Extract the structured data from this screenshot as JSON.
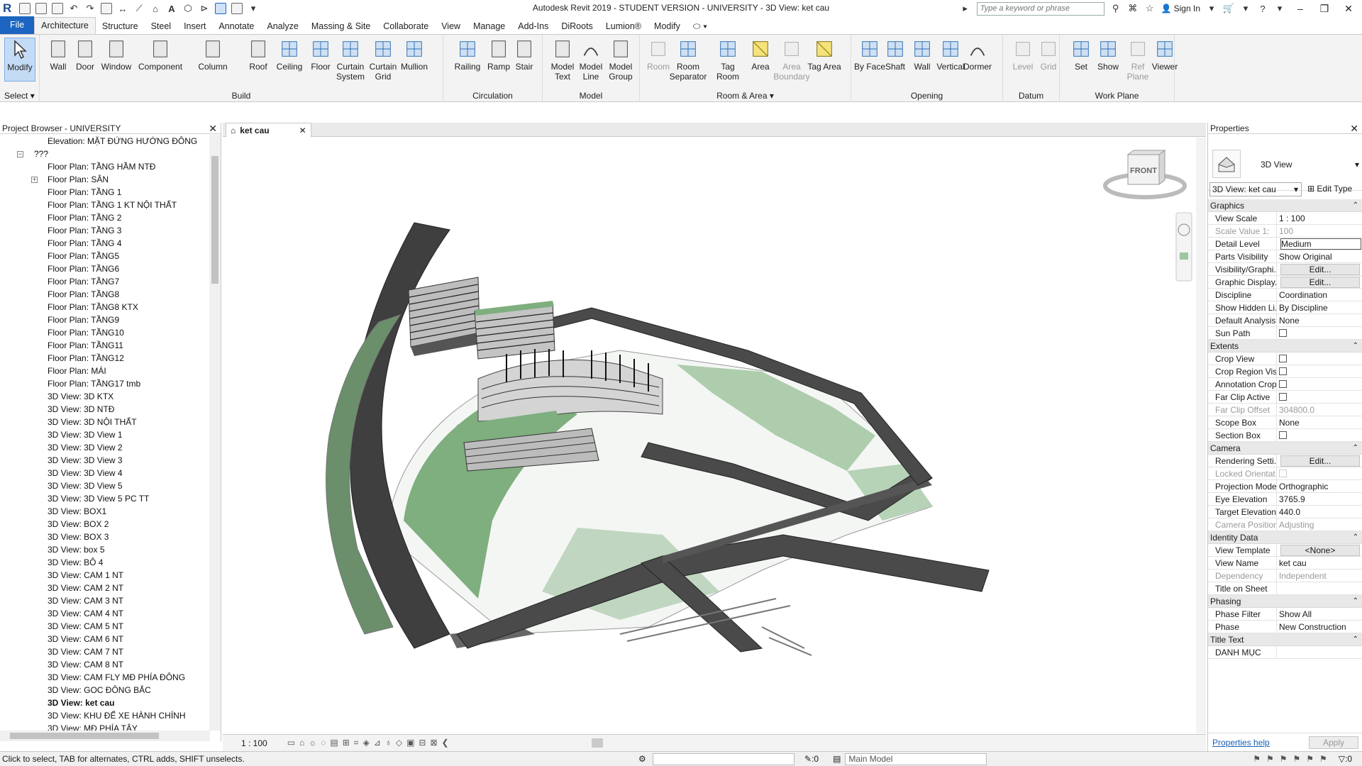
{
  "app": {
    "title": "Autodesk Revit 2019 - STUDENT VERSION - UNIVERSITY - 3D View: ket cau",
    "search_placeholder": "Type a keyword or phrase",
    "sign_in": "Sign In"
  },
  "tabs": [
    "File",
    "Architecture",
    "Structure",
    "Steel",
    "Insert",
    "Annotate",
    "Analyze",
    "Massing & Site",
    "Collaborate",
    "View",
    "Manage",
    "Add-Ins",
    "DiRoots",
    "Lumion®",
    "Modify"
  ],
  "ribbon": {
    "select_label": "Select",
    "modify": "Modify",
    "build": {
      "title": "Build",
      "items": [
        "Wall",
        "Door",
        "Window",
        "Component",
        "Column",
        "Roof",
        "Ceiling",
        "Floor",
        "Curtain System",
        "Curtain Grid",
        "Mullion"
      ]
    },
    "circulation": {
      "title": "Circulation",
      "items": [
        "Railing",
        "Ramp",
        "Stair"
      ]
    },
    "model": {
      "title": "Model",
      "items": [
        "Model Text",
        "Model Line",
        "Model Group"
      ]
    },
    "room_area": {
      "title": "Room & Area",
      "items": [
        "Room",
        "Room Separator",
        "Tag Room",
        "Area",
        "Area Boundary",
        "Tag Area"
      ]
    },
    "opening": {
      "title": "Opening",
      "items": [
        "By Face",
        "Shaft",
        "Wall",
        "Vertical",
        "Dormer"
      ]
    },
    "datum": {
      "title": "Datum",
      "items": [
        "Level",
        "Grid"
      ]
    },
    "workplane": {
      "title": "Work Plane",
      "items": [
        "Set",
        "Show",
        "Ref Plane",
        "Viewer"
      ]
    }
  },
  "browser": {
    "title": "Project Browser - UNIVERSITY",
    "elevation": "Elevation: MẶT ĐỨNG HƯỚNG ĐÔNG",
    "group": "???",
    "items": [
      "Floor Plan: TẦNG HẦM NTĐ",
      "Floor Plan: SÂN",
      "Floor Plan: TẦNG 1",
      "Floor Plan: TẦNG 1 KT NỘI THẤT",
      "Floor Plan: TẦNG 2",
      "Floor Plan: TẦNG 3",
      "Floor Plan: TẦNG 4",
      "Floor Plan: TẦNG5",
      "Floor Plan: TẦNG6",
      "Floor Plan: TẦNG7",
      "Floor Plan: TẦNG8",
      "Floor Plan: TẦNG8 KTX",
      "Floor Plan: TẦNG9",
      "Floor Plan: TẦNG10",
      "Floor Plan: TẦNG11",
      "Floor Plan: TẦNG12",
      "Floor Plan: MÁI",
      "Floor Plan: TẦNG17 tmb",
      "3D View: 3D KTX",
      "3D View: 3D NTĐ",
      "3D View: 3D NỘI THẤT",
      "3D View: 3D View 1",
      "3D View: 3D View 2",
      "3D View: 3D View 3",
      "3D View: 3D View 4",
      "3D View: 3D View 5",
      "3D View: 3D View 5 PC TT",
      "3D View: BOX1",
      "3D View: BOX 2",
      "3D View: BOX 3",
      "3D View: box 5",
      "3D View: BÔ 4",
      "3D View: CAM 1 NT",
      "3D View: CAM 2 NT",
      "3D View: CAM 3 NT",
      "3D View: CAM 4 NT",
      "3D View: CAM 5 NT",
      "3D View: CAM 6 NT",
      "3D View: CAM 7 NT",
      "3D View: CAM 8 NT",
      "3D View: CAM FLY MĐ PHÍA ĐÔNG",
      "3D View: GOC ĐÔNG  BẮC",
      "3D View: ket cau",
      "3D View: KHU ĐỂ XE HÀNH CHÍNH",
      "3D View: MĐ PHÍA TÂY"
    ]
  },
  "view": {
    "tab": "ket cau",
    "scale": "1 : 100",
    "cube_label": "FRONT"
  },
  "properties": {
    "title": "Properties",
    "type_name": "3D View",
    "selector": "3D View: ket cau",
    "edit_type": "Edit Type",
    "groups": [
      {
        "name": "Graphics",
        "rows": [
          [
            "View Scale",
            "1 : 100",
            ""
          ],
          [
            "Scale Value    1:",
            "100",
            "dim"
          ],
          [
            "Detail Level",
            "Medium",
            "hl"
          ],
          [
            "Parts Visibility",
            "Show Original",
            ""
          ],
          [
            "Visibility/Graphi...",
            "Edit...",
            "btn"
          ],
          [
            "Graphic Display...",
            "Edit...",
            "btn"
          ],
          [
            "Discipline",
            "Coordination",
            ""
          ],
          [
            "Show Hidden Li...",
            "By Discipline",
            ""
          ],
          [
            "Default Analysis...",
            "None",
            ""
          ],
          [
            "Sun Path",
            "",
            "cb"
          ]
        ]
      },
      {
        "name": "Extents",
        "rows": [
          [
            "Crop View",
            "",
            "cb"
          ],
          [
            "Crop Region Vis...",
            "",
            "cb"
          ],
          [
            "Annotation Crop",
            "",
            "cb"
          ],
          [
            "Far Clip Active",
            "",
            "cb"
          ],
          [
            "Far Clip Offset",
            "304800.0",
            "dim"
          ],
          [
            "Scope Box",
            "None",
            ""
          ],
          [
            "Section Box",
            "",
            "cb"
          ]
        ]
      },
      {
        "name": "Camera",
        "rows": [
          [
            "Rendering Setti...",
            "Edit...",
            "btn"
          ],
          [
            "Locked Orientat...",
            "",
            "dimcb"
          ],
          [
            "Projection Mode",
            "Orthographic",
            ""
          ],
          [
            "Eye Elevation",
            "3765.9",
            ""
          ],
          [
            "Target Elevation",
            "440.0",
            ""
          ],
          [
            "Camera Position",
            "Adjusting",
            "dim"
          ]
        ]
      },
      {
        "name": "Identity Data",
        "rows": [
          [
            "View Template",
            "<None>",
            "btn"
          ],
          [
            "View Name",
            "ket cau",
            ""
          ],
          [
            "Dependency",
            "Independent",
            "dim"
          ],
          [
            "Title on Sheet",
            "",
            ""
          ]
        ]
      },
      {
        "name": "Phasing",
        "rows": [
          [
            "Phase Filter",
            "Show All",
            ""
          ],
          [
            "Phase",
            "New Construction",
            ""
          ]
        ]
      },
      {
        "name": "Title Text",
        "rows": [
          [
            "DANH MỤC",
            "",
            ""
          ]
        ]
      }
    ],
    "help": "Properties help",
    "apply": "Apply"
  },
  "status": {
    "message": "Click to select, TAB for alternates, CTRL adds, SHIFT unselects.",
    "coord": ":0",
    "model": "Main Model",
    "filter": ":0"
  },
  "colors": {
    "accent": "#1c65c0",
    "site_green": "#7fae7f",
    "road": "#4a4a4a"
  }
}
